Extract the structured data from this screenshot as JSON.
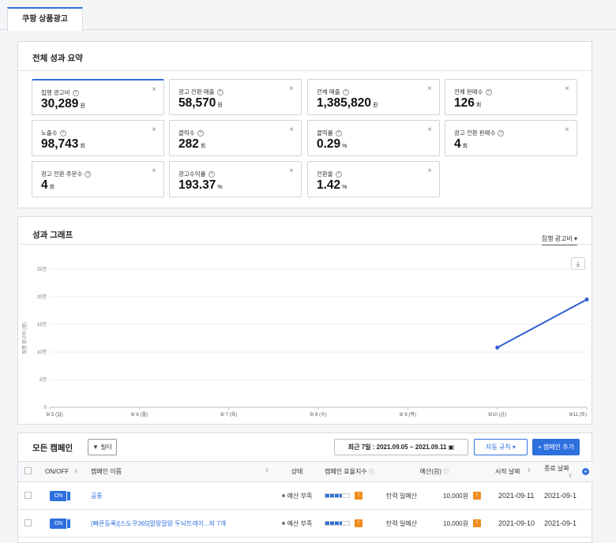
{
  "tab": {
    "label": "쿠팡 상품광고"
  },
  "summary": {
    "title": "전체 성과 요약",
    "cards": [
      {
        "label": "집행 광고비",
        "value": "30,289",
        "unit": "원"
      },
      {
        "label": "광고 전환 매출",
        "value": "58,570",
        "unit": "원"
      },
      {
        "label": "전체 매출",
        "value": "1,385,820",
        "unit": "원"
      },
      {
        "label": "전체 판매수",
        "value": "126",
        "unit": "회"
      },
      {
        "label": "노출수",
        "value": "98,743",
        "unit": "회"
      },
      {
        "label": "클릭수",
        "value": "282",
        "unit": "회"
      },
      {
        "label": "클릭률",
        "value": "0.29",
        "unit": "%"
      },
      {
        "label": "광고 전환 판매수",
        "value": "4",
        "unit": "회"
      },
      {
        "label": "광고 전환 주문수",
        "value": "4",
        "unit": "회"
      },
      {
        "label": "광고수익률",
        "value": "193.37",
        "unit": "%"
      },
      {
        "label": "전환율",
        "value": "1.42",
        "unit": "%"
      }
    ]
  },
  "graph": {
    "title": "성과 그래프",
    "metric_select": "집행 광고비 ▾",
    "download_icon": "download-icon"
  },
  "chart_data": {
    "type": "line",
    "ylabel": "집행 광고비 (원)",
    "ylim": [
      0,
      25
    ],
    "yticks": [
      "0",
      "5천",
      "10천",
      "15천",
      "20천",
      "25천"
    ],
    "categories": [
      "9/ 5 (일)",
      "9/ 6 (월)",
      "9/ 7 (화)",
      "9/ 8 (수)",
      "9/ 9 (목)",
      "9/10 (금)",
      "9/11 (토)"
    ],
    "series": [
      {
        "values": [
          null,
          null,
          null,
          null,
          null,
          10.8,
          19.5
        ],
        "color": "#2e5fd0"
      }
    ],
    "grid": true
  },
  "campaigns": {
    "title": "모든 캠페인",
    "filter_label": "필터",
    "date_range": "최근 7일 : 2021.09.05 ~ 2021.09.11",
    "auto_rule_label": "자동 규칙 ▾",
    "add_campaign_label": "+ 캠페인 추가",
    "columns": [
      "ON/OFF",
      "캠페인 이름",
      "상태",
      "캠페인 효율지수",
      "예산(원)",
      "시작 날짜",
      "종료 날짜"
    ],
    "rows": [
      {
        "toggle": "ON",
        "name": "공통",
        "status": "예산 부족",
        "budget_type": "탄력 일예산",
        "budget": "10,000원",
        "start": "2021-09-11",
        "end": "2021-09-1"
      },
      {
        "toggle": "ON",
        "name": "(빠른등록)[스도쿠365]말랑말랑 두뇌트레이...외 7개",
        "status": "예산 부족",
        "budget_type": "탄력 일예산",
        "budget": "10,000원",
        "start": "2021-09-10",
        "end": "2021-09-1"
      }
    ]
  }
}
